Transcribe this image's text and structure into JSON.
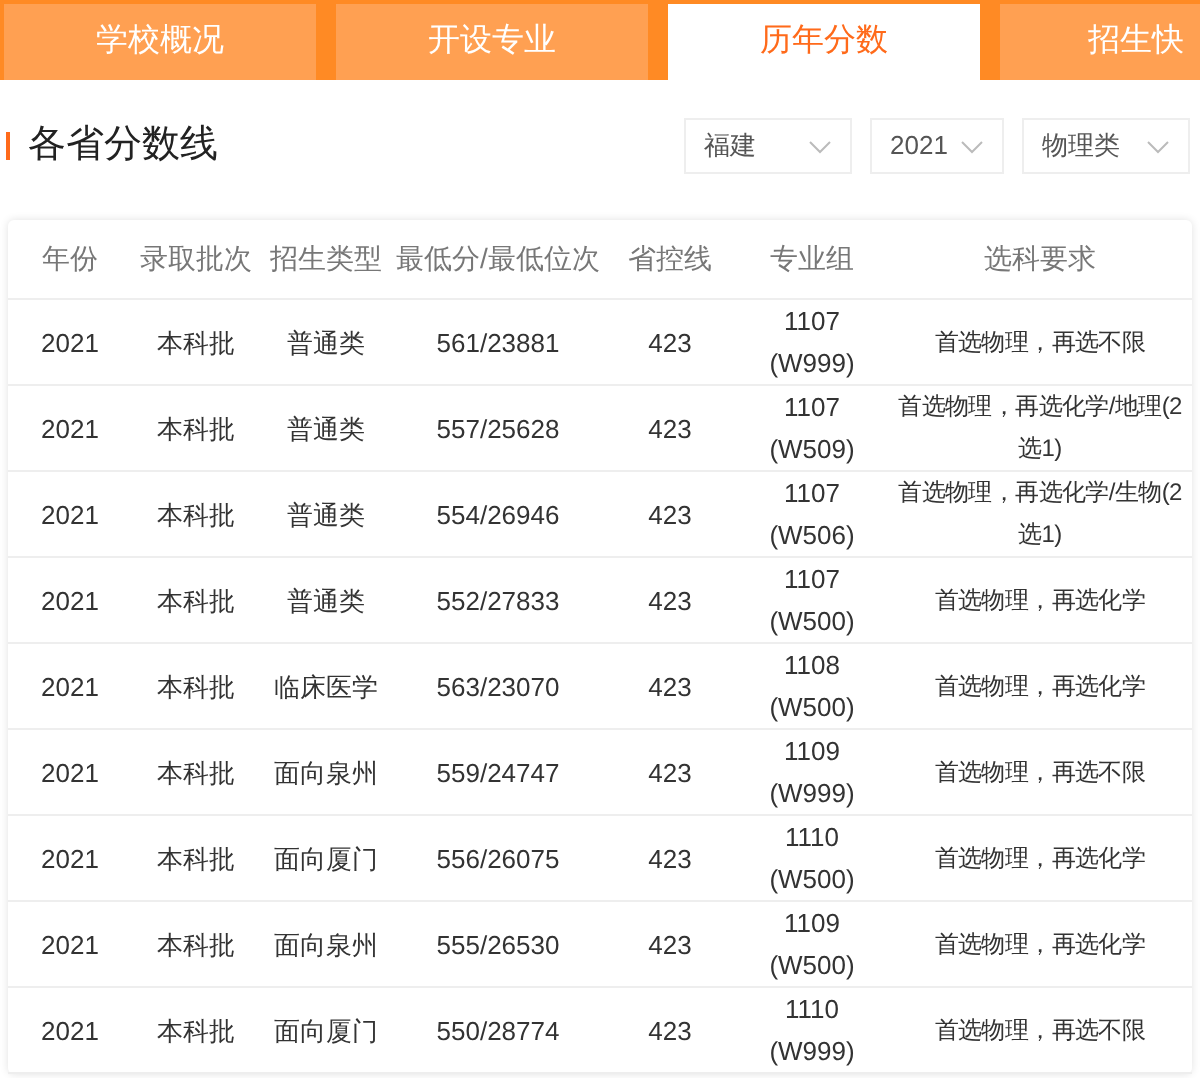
{
  "tabs": [
    {
      "label": "学校概况",
      "selected": false
    },
    {
      "label": "开设专业",
      "selected": false
    },
    {
      "label": "历年分数",
      "selected": true
    },
    {
      "label": "招生快",
      "selected": false
    }
  ],
  "section": {
    "title": "各省分数线"
  },
  "filters": [
    {
      "value": "福建"
    },
    {
      "value": "2021"
    },
    {
      "value": "物理类"
    }
  ],
  "table": {
    "columns": [
      "年份",
      "录取批次",
      "招生类型",
      "最低分/最低位次",
      "省控线",
      "专业组",
      "选科要求"
    ],
    "rows": [
      [
        "2021",
        "本科批",
        "普通类",
        "561/23881",
        "423",
        "1107\n(W999)",
        "首选物理，再选不限"
      ],
      [
        "2021",
        "本科批",
        "普通类",
        "557/25628",
        "423",
        "1107\n(W509)",
        "首选物理，再选化学/地理(2选1)"
      ],
      [
        "2021",
        "本科批",
        "普通类",
        "554/26946",
        "423",
        "1107\n(W506)",
        "首选物理，再选化学/生物(2选1)"
      ],
      [
        "2021",
        "本科批",
        "普通类",
        "552/27833",
        "423",
        "1107\n(W500)",
        "首选物理，再选化学"
      ],
      [
        "2021",
        "本科批",
        "临床医学",
        "563/23070",
        "423",
        "1108\n(W500)",
        "首选物理，再选化学"
      ],
      [
        "2021",
        "本科批",
        "面向泉州",
        "559/24747",
        "423",
        "1109\n(W999)",
        "首选物理，再选不限"
      ],
      [
        "2021",
        "本科批",
        "面向厦门",
        "556/26075",
        "423",
        "1110\n(W500)",
        "首选物理，再选化学"
      ],
      [
        "2021",
        "本科批",
        "面向泉州",
        "555/26530",
        "423",
        "1109\n(W500)",
        "首选物理，再选化学"
      ],
      [
        "2021",
        "本科批",
        "面向厦门",
        "550/28774",
        "423",
        "1110\n(W999)",
        "首选物理，再选不限"
      ]
    ]
  }
}
